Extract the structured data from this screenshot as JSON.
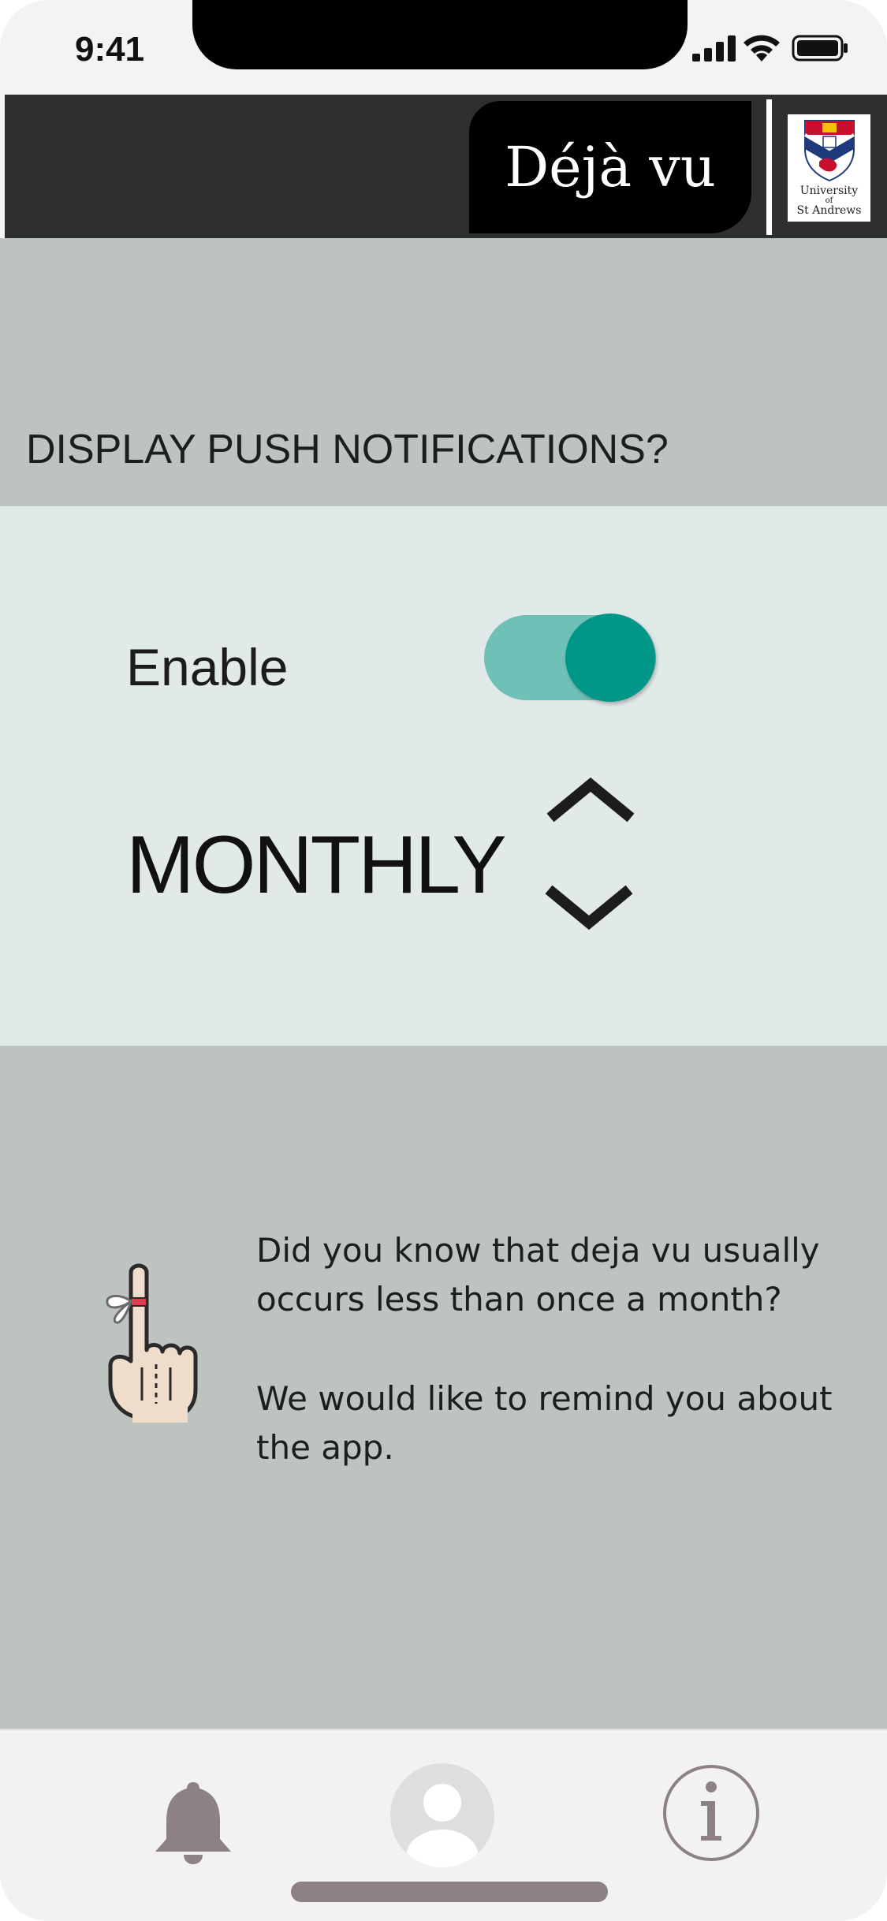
{
  "status_bar": {
    "time": "9:41"
  },
  "header": {
    "app_title": "Déjà vu",
    "logo": {
      "line1": "University",
      "line2": "of",
      "line3": "St Andrews"
    }
  },
  "notifications": {
    "heading": "DISPLAY PUSH NOTIFICATIONS?",
    "enable_label": "Enable",
    "enabled": true,
    "frequency": "MONTHLY"
  },
  "info": {
    "paragraph1": "Did you know that deja vu usually occurs less than once a month?",
    "paragraph2": "We would like to remind you about the app."
  },
  "tab_bar": {
    "items": [
      {
        "name": "notifications",
        "icon": "bell-icon"
      },
      {
        "name": "profile",
        "icon": "user-icon"
      },
      {
        "name": "info",
        "icon": "info-icon"
      }
    ]
  },
  "colors": {
    "header_bg": "#2e2f2f",
    "section_gray": "#bdc4c0",
    "section_light": "#e2e9e9",
    "toggle_track": "#6fc1b7",
    "toggle_knob": "#009688",
    "tab_icon": "#8c8183"
  }
}
